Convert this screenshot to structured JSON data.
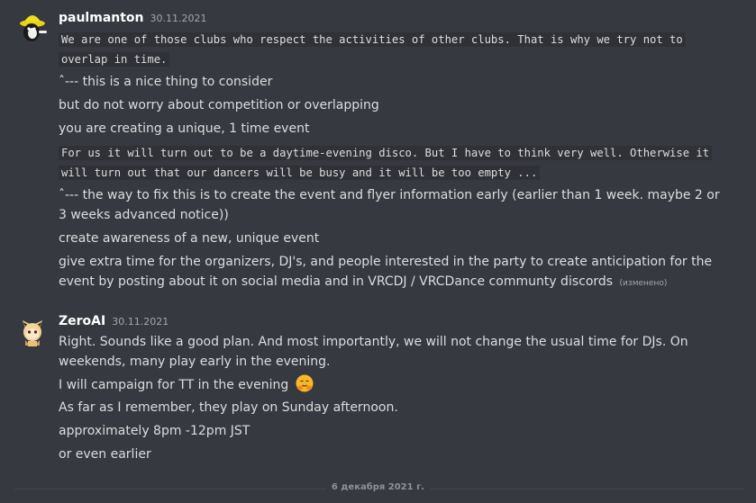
{
  "messages": [
    {
      "author": "paulmanton",
      "timestamp": "30.11.2021",
      "lines": {
        "l1": "We are one of those clubs who respect the activities of other clubs. That is why we try not to overlap in time.",
        "l2": "ˆ--- this is a nice thing to consider",
        "l3": "but do not worry about competition or overlapping",
        "l4": "you are creating a unique, 1 time event",
        "l5": "For us it will turn out to be a daytime-evening disco. But I have to think very well. Otherwise it will turn out that our dancers will be busy and it will be too empty ...",
        "l6": "ˆ--- the way to fix this is to create the event and flyer information early (earlier than 1 week. maybe 2 or 3 weeks advanced notice))",
        "l7": "create awareness of a new, unique event",
        "l8": "give extra time for the organizers, DJ's, and people interested in the party to create anticipation for the event by posting about it on social media and in VRCDJ / VRCDance communty discords",
        "edited": "(изменено)"
      }
    },
    {
      "author": "ZeroAI",
      "timestamp": "30.11.2021",
      "lines": {
        "l1": "Right. Sounds like a good plan. And most importantly, we will not change the usual time for DJs. On weekends, many play early in the evening.",
        "l2": "I will campaign for TT in the evening",
        "l3": "As far as I remember, they play on Sunday afternoon.",
        "l4": "approximately 8pm -12pm JST",
        "l5": "or even earlier",
        "emoji": "hugging-face-emoji"
      }
    }
  ],
  "date_divider": "6 декабря 2021 г.",
  "colors": {
    "background": "#36393f",
    "username": "#ffffff",
    "text": "#dcddde",
    "muted": "#a3a6aa",
    "code_bg": "#2f3136"
  }
}
